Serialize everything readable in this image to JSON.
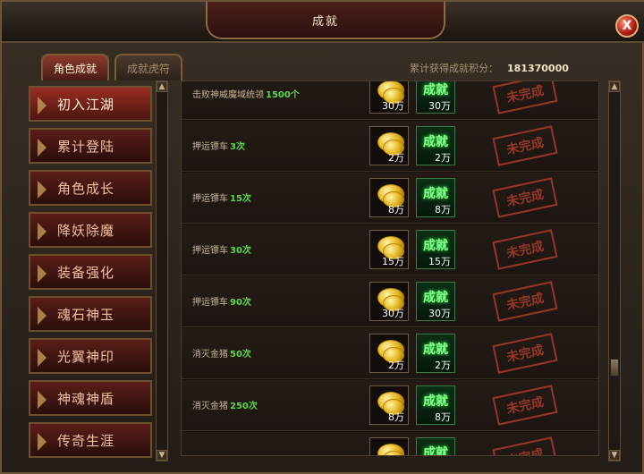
{
  "window": {
    "title": "成就",
    "close_glyph": "X"
  },
  "tabs": [
    {
      "label": "角色成就",
      "active": true
    },
    {
      "label": "成就虎符",
      "active": false
    }
  ],
  "score": {
    "label": "累计获得成就积分：",
    "value": "181370000"
  },
  "sidebar": {
    "items": [
      {
        "label": "初入江湖",
        "active": true
      },
      {
        "label": "累计登陆",
        "active": false
      },
      {
        "label": "角色成长",
        "active": false
      },
      {
        "label": "降妖除魔",
        "active": false
      },
      {
        "label": "装备强化",
        "active": false
      },
      {
        "label": "魂石神玉",
        "active": false
      },
      {
        "label": "光翼神印",
        "active": false
      },
      {
        "label": "神魂神盾",
        "active": false
      },
      {
        "label": "传奇生涯",
        "active": false
      }
    ]
  },
  "achievements": {
    "items": [
      {
        "text": "击败神威魔域统领",
        "count": "1500个",
        "coin_reward": "30万",
        "achievement_reward": "30万",
        "status": "未完成"
      },
      {
        "text": "押运镖车",
        "count": "3次",
        "coin_reward": "2万",
        "achievement_reward": "2万",
        "status": "未完成"
      },
      {
        "text": "押运镖车",
        "count": "15次",
        "coin_reward": "8万",
        "achievement_reward": "8万",
        "status": "未完成"
      },
      {
        "text": "押运镖车",
        "count": "30次",
        "coin_reward": "15万",
        "achievement_reward": "15万",
        "status": "未完成"
      },
      {
        "text": "押运镖车",
        "count": "90次",
        "coin_reward": "30万",
        "achievement_reward": "30万",
        "status": "未完成"
      },
      {
        "text": "消灭金猪",
        "count": "50次",
        "coin_reward": "2万",
        "achievement_reward": "2万",
        "status": "未完成"
      },
      {
        "text": "消灭金猪",
        "count": "250次",
        "coin_reward": "8万",
        "achievement_reward": "8万",
        "status": "未完成"
      },
      {
        "text": "",
        "count": "",
        "coin_reward": "",
        "achievement_reward": "",
        "status": "未完成"
      }
    ],
    "achievement_icon_label": "成就"
  },
  "colors": {
    "accent_red": "#9a2d22",
    "success_green": "#5fd64a",
    "gold": "#e3b21b"
  },
  "icons": {
    "close": "close-icon",
    "coin": "gold-coin-icon",
    "achievement": "achievement-icon",
    "scroll_up": "scroll-up-icon",
    "scroll_down": "scroll-down-icon"
  },
  "scrollbars": {
    "sidebar_up": "▲",
    "sidebar_down": "▼",
    "list_up": "▲",
    "list_down": "▼"
  }
}
